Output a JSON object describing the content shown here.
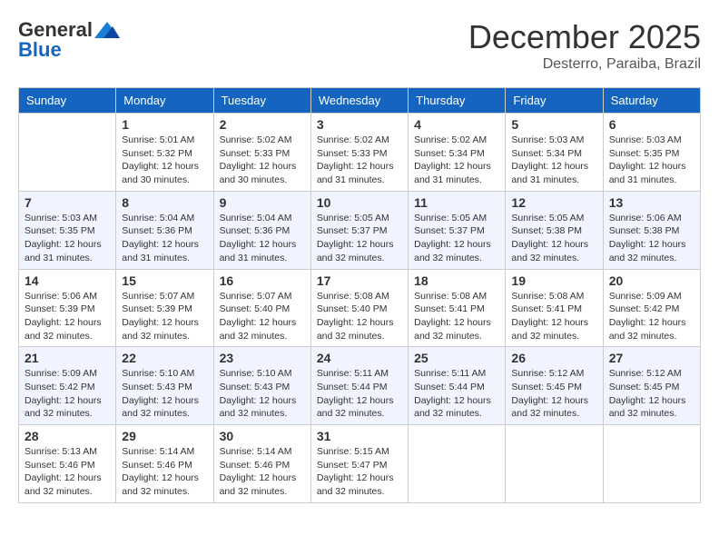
{
  "header": {
    "logo_line1": "General",
    "logo_line2": "Blue",
    "month": "December 2025",
    "location": "Desterro, Paraiba, Brazil"
  },
  "days_of_week": [
    "Sunday",
    "Monday",
    "Tuesday",
    "Wednesday",
    "Thursday",
    "Friday",
    "Saturday"
  ],
  "weeks": [
    [
      {
        "day": "",
        "sunrise": "",
        "sunset": "",
        "daylight": ""
      },
      {
        "day": "1",
        "sunrise": "Sunrise: 5:01 AM",
        "sunset": "Sunset: 5:32 PM",
        "daylight": "Daylight: 12 hours and 30 minutes."
      },
      {
        "day": "2",
        "sunrise": "Sunrise: 5:02 AM",
        "sunset": "Sunset: 5:33 PM",
        "daylight": "Daylight: 12 hours and 30 minutes."
      },
      {
        "day": "3",
        "sunrise": "Sunrise: 5:02 AM",
        "sunset": "Sunset: 5:33 PM",
        "daylight": "Daylight: 12 hours and 31 minutes."
      },
      {
        "day": "4",
        "sunrise": "Sunrise: 5:02 AM",
        "sunset": "Sunset: 5:34 PM",
        "daylight": "Daylight: 12 hours and 31 minutes."
      },
      {
        "day": "5",
        "sunrise": "Sunrise: 5:03 AM",
        "sunset": "Sunset: 5:34 PM",
        "daylight": "Daylight: 12 hours and 31 minutes."
      },
      {
        "day": "6",
        "sunrise": "Sunrise: 5:03 AM",
        "sunset": "Sunset: 5:35 PM",
        "daylight": "Daylight: 12 hours and 31 minutes."
      }
    ],
    [
      {
        "day": "7",
        "sunrise": "Sunrise: 5:03 AM",
        "sunset": "Sunset: 5:35 PM",
        "daylight": "Daylight: 12 hours and 31 minutes."
      },
      {
        "day": "8",
        "sunrise": "Sunrise: 5:04 AM",
        "sunset": "Sunset: 5:36 PM",
        "daylight": "Daylight: 12 hours and 31 minutes."
      },
      {
        "day": "9",
        "sunrise": "Sunrise: 5:04 AM",
        "sunset": "Sunset: 5:36 PM",
        "daylight": "Daylight: 12 hours and 31 minutes."
      },
      {
        "day": "10",
        "sunrise": "Sunrise: 5:05 AM",
        "sunset": "Sunset: 5:37 PM",
        "daylight": "Daylight: 12 hours and 32 minutes."
      },
      {
        "day": "11",
        "sunrise": "Sunrise: 5:05 AM",
        "sunset": "Sunset: 5:37 PM",
        "daylight": "Daylight: 12 hours and 32 minutes."
      },
      {
        "day": "12",
        "sunrise": "Sunrise: 5:05 AM",
        "sunset": "Sunset: 5:38 PM",
        "daylight": "Daylight: 12 hours and 32 minutes."
      },
      {
        "day": "13",
        "sunrise": "Sunrise: 5:06 AM",
        "sunset": "Sunset: 5:38 PM",
        "daylight": "Daylight: 12 hours and 32 minutes."
      }
    ],
    [
      {
        "day": "14",
        "sunrise": "Sunrise: 5:06 AM",
        "sunset": "Sunset: 5:39 PM",
        "daylight": "Daylight: 12 hours and 32 minutes."
      },
      {
        "day": "15",
        "sunrise": "Sunrise: 5:07 AM",
        "sunset": "Sunset: 5:39 PM",
        "daylight": "Daylight: 12 hours and 32 minutes."
      },
      {
        "day": "16",
        "sunrise": "Sunrise: 5:07 AM",
        "sunset": "Sunset: 5:40 PM",
        "daylight": "Daylight: 12 hours and 32 minutes."
      },
      {
        "day": "17",
        "sunrise": "Sunrise: 5:08 AM",
        "sunset": "Sunset: 5:40 PM",
        "daylight": "Daylight: 12 hours and 32 minutes."
      },
      {
        "day": "18",
        "sunrise": "Sunrise: 5:08 AM",
        "sunset": "Sunset: 5:41 PM",
        "daylight": "Daylight: 12 hours and 32 minutes."
      },
      {
        "day": "19",
        "sunrise": "Sunrise: 5:08 AM",
        "sunset": "Sunset: 5:41 PM",
        "daylight": "Daylight: 12 hours and 32 minutes."
      },
      {
        "day": "20",
        "sunrise": "Sunrise: 5:09 AM",
        "sunset": "Sunset: 5:42 PM",
        "daylight": "Daylight: 12 hours and 32 minutes."
      }
    ],
    [
      {
        "day": "21",
        "sunrise": "Sunrise: 5:09 AM",
        "sunset": "Sunset: 5:42 PM",
        "daylight": "Daylight: 12 hours and 32 minutes."
      },
      {
        "day": "22",
        "sunrise": "Sunrise: 5:10 AM",
        "sunset": "Sunset: 5:43 PM",
        "daylight": "Daylight: 12 hours and 32 minutes."
      },
      {
        "day": "23",
        "sunrise": "Sunrise: 5:10 AM",
        "sunset": "Sunset: 5:43 PM",
        "daylight": "Daylight: 12 hours and 32 minutes."
      },
      {
        "day": "24",
        "sunrise": "Sunrise: 5:11 AM",
        "sunset": "Sunset: 5:44 PM",
        "daylight": "Daylight: 12 hours and 32 minutes."
      },
      {
        "day": "25",
        "sunrise": "Sunrise: 5:11 AM",
        "sunset": "Sunset: 5:44 PM",
        "daylight": "Daylight: 12 hours and 32 minutes."
      },
      {
        "day": "26",
        "sunrise": "Sunrise: 5:12 AM",
        "sunset": "Sunset: 5:45 PM",
        "daylight": "Daylight: 12 hours and 32 minutes."
      },
      {
        "day": "27",
        "sunrise": "Sunrise: 5:12 AM",
        "sunset": "Sunset: 5:45 PM",
        "daylight": "Daylight: 12 hours and 32 minutes."
      }
    ],
    [
      {
        "day": "28",
        "sunrise": "Sunrise: 5:13 AM",
        "sunset": "Sunset: 5:46 PM",
        "daylight": "Daylight: 12 hours and 32 minutes."
      },
      {
        "day": "29",
        "sunrise": "Sunrise: 5:14 AM",
        "sunset": "Sunset: 5:46 PM",
        "daylight": "Daylight: 12 hours and 32 minutes."
      },
      {
        "day": "30",
        "sunrise": "Sunrise: 5:14 AM",
        "sunset": "Sunset: 5:46 PM",
        "daylight": "Daylight: 12 hours and 32 minutes."
      },
      {
        "day": "31",
        "sunrise": "Sunrise: 5:15 AM",
        "sunset": "Sunset: 5:47 PM",
        "daylight": "Daylight: 12 hours and 32 minutes."
      },
      {
        "day": "",
        "sunrise": "",
        "sunset": "",
        "daylight": ""
      },
      {
        "day": "",
        "sunrise": "",
        "sunset": "",
        "daylight": ""
      },
      {
        "day": "",
        "sunrise": "",
        "sunset": "",
        "daylight": ""
      }
    ]
  ]
}
